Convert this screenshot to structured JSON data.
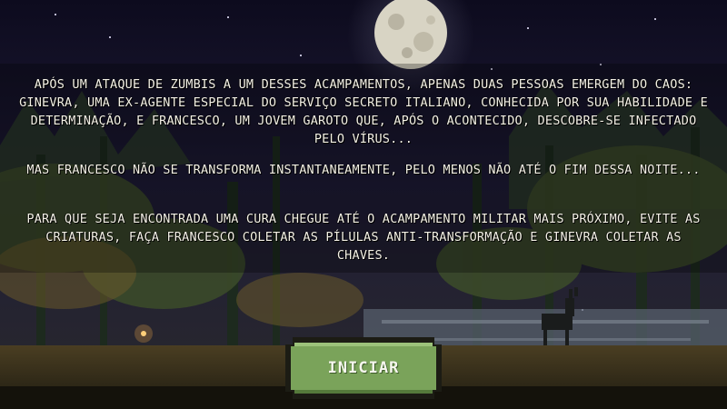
{
  "story": {
    "paragraph_1": "Após um ataque de zumbis a um desses acampamentos, apenas duas pessoas emergem do caos: Ginevra, uma ex-agente especial do serviço secreto italiano, conhecida por sua habilidade e determinação, e Francesco, um jovem garoto que, após o acontecido, descobre-se infectado pelo vírus...",
    "paragraph_2": "Mas Francesco não se transforma instantaneamente, pelo menos não até o fim dessa noite...",
    "paragraph_3": "Para que seja encontrada uma cura chegue até o acampamento militar mais próximo, evite as criaturas, faça Francesco coletar as pílulas anti-transformação e Ginevra coletar as chaves."
  },
  "start_button": {
    "label": "INICIAR"
  },
  "colors": {
    "sky": "#16142e",
    "moon": "#d9d5c5",
    "button_green": "#7aa35a",
    "text": "#f4f1e6"
  }
}
